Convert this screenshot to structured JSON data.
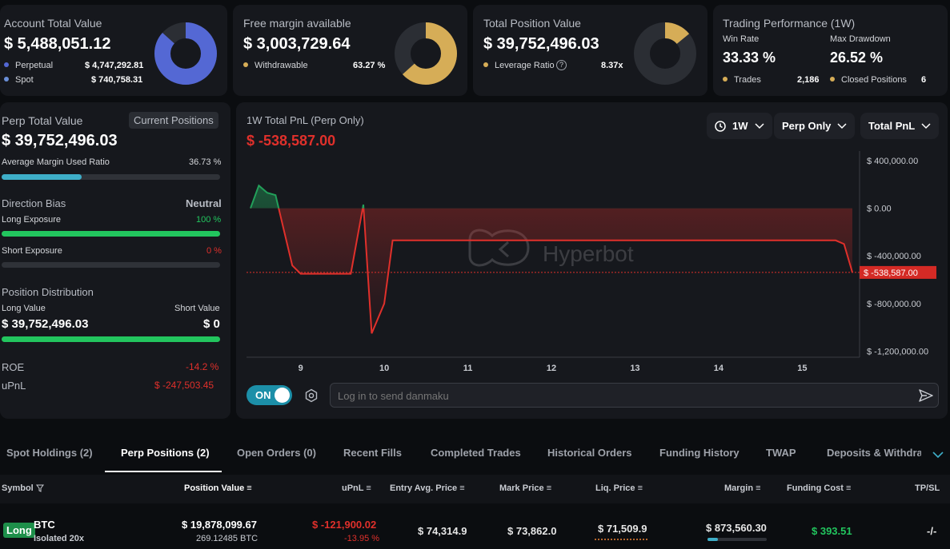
{
  "account": {
    "title": "Account Total Value",
    "value": "$ 5,488,051.12",
    "perp_label": "Perpetual",
    "perp_value": "$ 4,747,292.81",
    "spot_label": "Spot",
    "spot_value": "$ 740,758.31",
    "perp_color": "#5468d4",
    "spot_color": "#6a8fd8",
    "perp_fraction": 0.865
  },
  "margin": {
    "title": "Free margin available",
    "value": "$ 3,003,729.64",
    "withdrawable_label": "Withdrawable",
    "withdrawable_value": "63.27 %",
    "color": "#d6ad57",
    "fraction": 0.6327
  },
  "position": {
    "title": "Total Position Value",
    "value": "$ 39,752,496.03",
    "leverage_label": "Leverage Ratio",
    "leverage_value": "8.37x",
    "color": "#d6ad57",
    "fraction": 0.14
  },
  "performance": {
    "title": "Trading Performance (1W)",
    "win_rate_label": "Win Rate",
    "win_rate_value": "33.33 %",
    "drawdown_label": "Max Drawdown",
    "drawdown_value": "26.52 %",
    "trades_label": "Trades",
    "trades_value": "2,186",
    "closed_label": "Closed Positions",
    "closed_value": "6"
  },
  "perp": {
    "title": "Perp Total Value",
    "badge": "Current Positions",
    "value": "$ 39,752,496.03",
    "margin_ratio_label": "Average Margin Used Ratio",
    "margin_ratio_value": "36.73 %",
    "margin_ratio_fraction": 0.3673,
    "bias_label": "Direction Bias",
    "bias_value": "Neutral",
    "long_label": "Long Exposure",
    "long_value": "100 %",
    "long_fraction": 1.0,
    "short_label": "Short Exposure",
    "short_value": "0 %",
    "short_fraction": 0.0,
    "dist_label": "Position Distribution",
    "long_value_label": "Long Value",
    "short_value_label": "Short Value",
    "long_amount": "$ 39,752,496.03",
    "short_amount": "$ 0",
    "dist_long_fraction": 1.0,
    "roe_label": "ROE",
    "roe_value": "-14.2 %",
    "upnl_label": "uPnL",
    "upnl_value": "$ -247,503.45"
  },
  "pnl": {
    "title": "1W Total PnL (Perp Only)",
    "value": "$ -538,587.00",
    "filters": {
      "period": "1W",
      "scope": "Perp Only",
      "metric": "Total PnL"
    },
    "watermark": "Hyperbot",
    "toggle": "ON",
    "danmaku_placeholder": "Log in to send danmaku"
  },
  "chart_data": {
    "type": "area",
    "x_ticks": [
      9,
      10,
      11,
      12,
      13,
      14,
      15
    ],
    "y_ticks": [
      "$ 400,000.00",
      "$ 0.00",
      "$ -400,000.00",
      "$ -800,000.00",
      "$ -1,200,000.00"
    ],
    "y_tick_values": [
      400000,
      0,
      -400000,
      -800000,
      -1200000
    ],
    "ylim": [
      -1250000,
      480000
    ],
    "xlim": [
      8.4,
      15.6
    ],
    "current_label": "$ -538,587.00",
    "current_value": -538587,
    "points": [
      [
        8.4,
        0
      ],
      [
        8.5,
        190000
      ],
      [
        8.6,
        130000
      ],
      [
        8.7,
        110000
      ],
      [
        8.9,
        -480000
      ],
      [
        9.0,
        -550000
      ],
      [
        9.3,
        -550000
      ],
      [
        9.6,
        -550000
      ],
      [
        9.75,
        30000
      ],
      [
        9.85,
        -1050000
      ],
      [
        10.0,
        -800000
      ],
      [
        10.1,
        -270000
      ],
      [
        10.5,
        -270000
      ],
      [
        12.0,
        -270000
      ],
      [
        14.0,
        -270000
      ],
      [
        15.4,
        -270000
      ],
      [
        15.5,
        -300000
      ],
      [
        15.6,
        -538587
      ]
    ],
    "up_color": "#22a05a",
    "down_color": "#e0302b"
  },
  "tabs": [
    "Spot Holdings (2)",
    "Perp Positions (2)",
    "Open Orders (0)",
    "Recent Fills",
    "Completed Trades",
    "Historical Orders",
    "Funding History",
    "TWAP",
    "Deposits & Withdraw"
  ],
  "table": {
    "headers": [
      "Symbol",
      "Position Value",
      "uPnL",
      "Entry Avg. Price",
      "Mark Price",
      "Liq. Price",
      "Margin",
      "Funding Cost",
      "TP/SL"
    ],
    "row": {
      "side": "Long",
      "symbol": "BTC",
      "mode": "Isolated 20x",
      "position_value": "$ 19,878,099.67",
      "position_size": "269.12485 BTC",
      "upnl": "$ -121,900.02",
      "upnl_pct": "-13.95 %",
      "entry": "$ 74,314.9",
      "mark": "$ 73,862.0",
      "liq": "$ 71,509.9",
      "margin": "$ 873,560.30",
      "margin_fraction": 0.18,
      "funding": "$ 393.51",
      "tpsl": "-/-"
    }
  }
}
